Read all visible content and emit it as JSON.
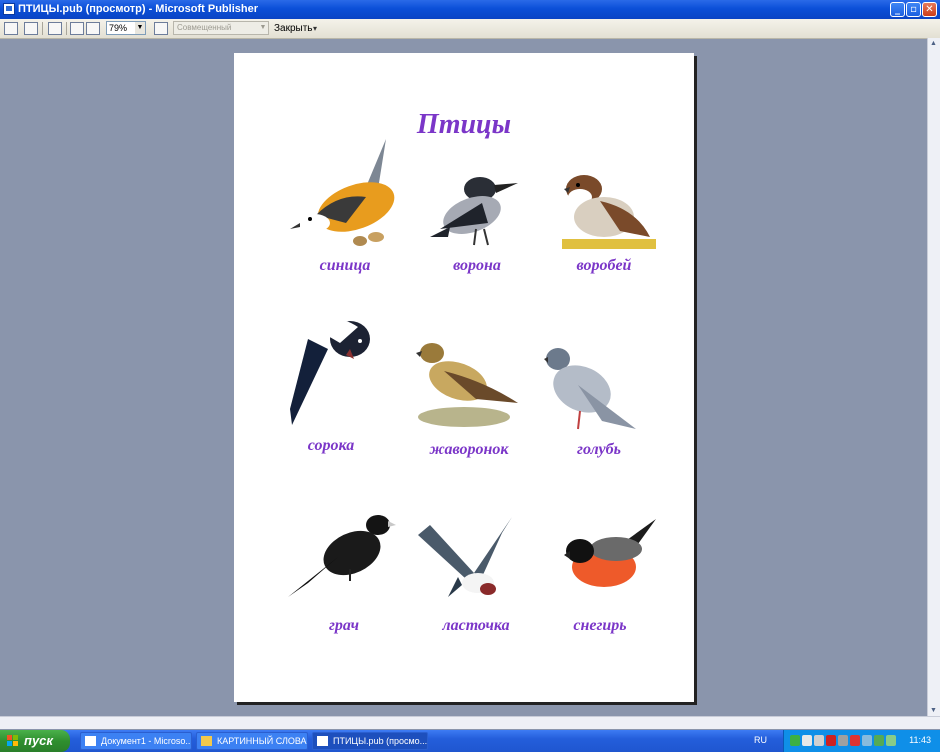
{
  "window": {
    "title": "ПТИЦЫ.pub (просмотр)  - Microsoft Publisher",
    "minimize": "_",
    "maximize": "▫",
    "close": "✕"
  },
  "toolbar": {
    "zoom": "79%",
    "mode": "Совмещенный",
    "close_label": "Закрыть"
  },
  "page": {
    "title": "Птицы",
    "birds": [
      {
        "name": "синица",
        "icon": "tit-icon"
      },
      {
        "name": "ворона",
        "icon": "crow-icon"
      },
      {
        "name": "воробей",
        "icon": "sparrow-icon"
      },
      {
        "name": "сорока",
        "icon": "magpie-icon"
      },
      {
        "name": "жаворонок",
        "icon": "lark-icon"
      },
      {
        "name": "голубь",
        "icon": "pigeon-icon"
      },
      {
        "name": "грач",
        "icon": "rook-icon"
      },
      {
        "name": "ласточка",
        "icon": "swallow-icon"
      },
      {
        "name": "снегирь",
        "icon": "bullfinch-icon"
      }
    ]
  },
  "taskbar": {
    "start": "пуск",
    "tasks": [
      "Документ1 - Microso...",
      "КАРТИННЫЙ СЛОВА...",
      "ПТИЦЫ.pub (просмо..."
    ],
    "lang": "RU",
    "clock": "11:43"
  },
  "colors": {
    "label_purple": "#7b36c8",
    "workspace": "#8a95ac"
  }
}
